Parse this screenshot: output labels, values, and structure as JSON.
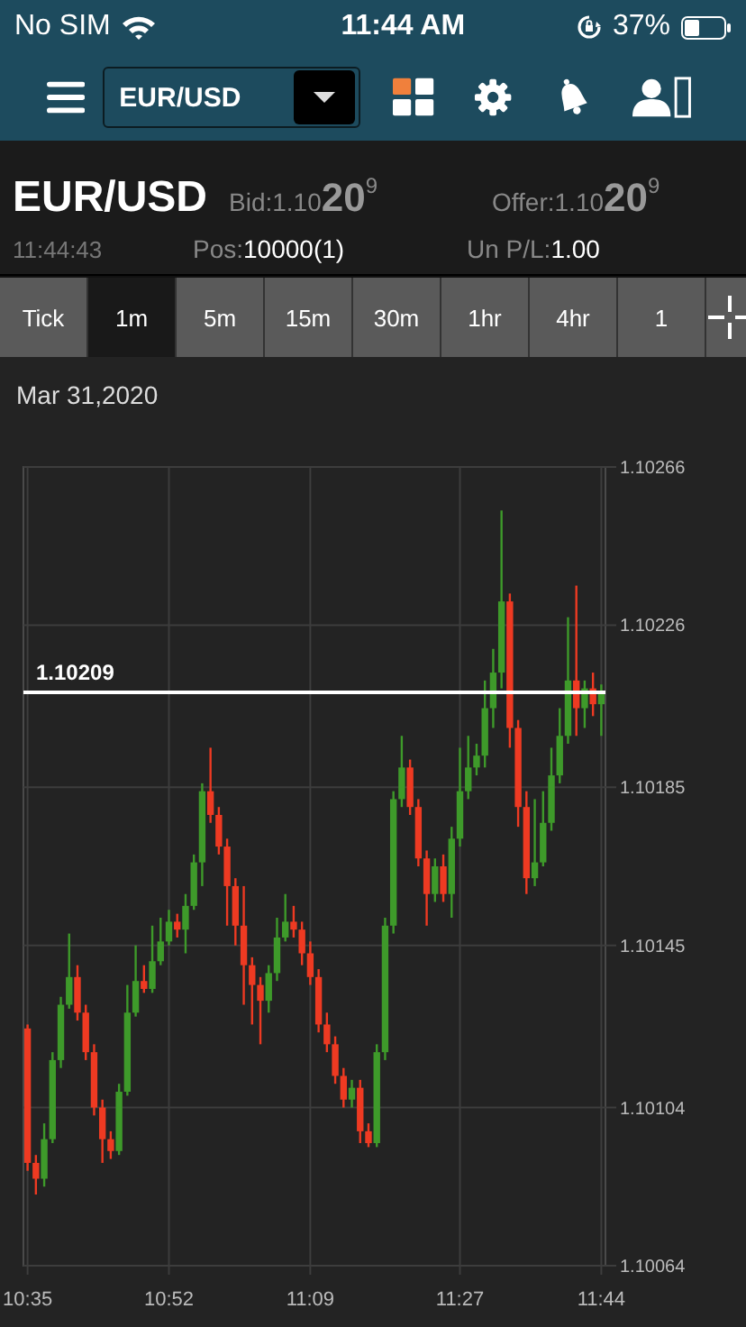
{
  "status_bar": {
    "carrier": "No SIM",
    "time": "11:44 AM",
    "battery": "37%"
  },
  "toolbar": {
    "symbol_select": {
      "value": "EUR/USD"
    }
  },
  "quote": {
    "symbol": "EUR/USD",
    "time": "11:44:43",
    "bid_label": "Bid:",
    "bid": "1.10**20**$^{9}$",
    "offer_label": "Offer:",
    "offer": "1.10**20**$^{9}$",
    "pos_label": "Pos:",
    "pos": "10000(1)",
    "pl_label": "Un P/L:",
    "pl": "1.00"
  },
  "tabs": [
    {
      "label": "Tick",
      "selected": false
    },
    {
      "label": "1m",
      "selected": true
    },
    {
      "label": "5m",
      "selected": false
    },
    {
      "label": "15m",
      "selected": false
    },
    {
      "label": "30m",
      "selected": false
    },
    {
      "label": "1hr",
      "selected": false
    },
    {
      "label": "4hr",
      "selected": false
    },
    {
      "label": "1",
      "selected": false
    }
  ],
  "chart": {
    "date": "Mar 31,2020",
    "chart_data": {
      "type": "candlestick",
      "ylim": [
        1.10064,
        1.10266
      ],
      "grid": true,
      "categories": [
        "10:35",
        null,
        null,
        null,
        null,
        null,
        null,
        null,
        null,
        null,
        null,
        null,
        null,
        null,
        null,
        null,
        null,
        "10:52",
        null,
        null,
        null,
        null,
        null,
        null,
        null,
        null,
        null,
        null,
        null,
        null,
        null,
        null,
        null,
        null,
        "11:09",
        null,
        null,
        null,
        null,
        null,
        null,
        null,
        null,
        null,
        null,
        null,
        null,
        null,
        null,
        null,
        null,
        null,
        "11:27",
        null,
        null,
        null,
        null,
        null,
        null,
        null,
        null,
        null,
        null,
        null,
        null,
        null,
        null,
        null,
        null,
        "11:44"
      ],
      "yticks": [
        1.10064,
        1.10104,
        1.10145,
        1.10185,
        1.10226,
        1.10266
      ],
      "ref_lines": [
        {
          "axis": "y",
          "value": 1.10209,
          "label": "1.10209"
        }
      ],
      "ohlc": [
        [
          1.10124,
          1.10125,
          1.10088,
          1.1009
        ],
        [
          1.1009,
          1.10092,
          1.10082,
          1.10086
        ],
        [
          1.10086,
          1.101,
          1.10084,
          1.10096
        ],
        [
          1.10096,
          1.10118,
          1.10095,
          1.10116
        ],
        [
          1.10116,
          1.10132,
          1.10114,
          1.1013
        ],
        [
          1.1013,
          1.10148,
          1.10129,
          1.10137
        ],
        [
          1.10137,
          1.1014,
          1.10126,
          1.10128
        ],
        [
          1.10128,
          1.1013,
          1.10116,
          1.10118
        ],
        [
          1.10118,
          1.1012,
          1.10102,
          1.10104
        ],
        [
          1.10104,
          1.10106,
          1.1009,
          1.10096
        ],
        [
          1.10096,
          1.10098,
          1.10091,
          1.10093
        ],
        [
          1.10093,
          1.1011,
          1.10092,
          1.10108
        ],
        [
          1.10108,
          1.10135,
          1.10107,
          1.10128
        ],
        [
          1.10128,
          1.10145,
          1.10127,
          1.10136
        ],
        [
          1.10136,
          1.1014,
          1.10133,
          1.10134
        ],
        [
          1.10134,
          1.1015,
          1.10133,
          1.10141
        ],
        [
          1.10141,
          1.10152,
          1.1014,
          1.10146
        ],
        [
          1.10146,
          1.10154,
          1.10145,
          1.10151
        ],
        [
          1.10151,
          1.10153,
          1.10147,
          1.10149
        ],
        [
          1.10149,
          1.10158,
          1.10143,
          1.10155
        ],
        [
          1.10155,
          1.10168,
          1.10154,
          1.10166
        ],
        [
          1.10166,
          1.10186,
          1.1016,
          1.10184
        ],
        [
          1.10184,
          1.10195,
          1.10176,
          1.10178
        ],
        [
          1.10178,
          1.1018,
          1.10168,
          1.1017
        ],
        [
          1.1017,
          1.10172,
          1.1015,
          1.1016
        ],
        [
          1.1016,
          1.10162,
          1.10145,
          1.1015
        ],
        [
          1.1015,
          1.1016,
          1.1013,
          1.1014
        ],
        [
          1.1014,
          1.10142,
          1.10125,
          1.10135
        ],
        [
          1.10135,
          1.10137,
          1.1012,
          1.10131
        ],
        [
          1.10131,
          1.1014,
          1.10128,
          1.10138
        ],
        [
          1.10138,
          1.10152,
          1.10136,
          1.10147
        ],
        [
          1.10147,
          1.10158,
          1.10146,
          1.10151
        ],
        [
          1.10151,
          1.10155,
          1.10147,
          1.10149
        ],
        [
          1.10149,
          1.10151,
          1.1014,
          1.10143
        ],
        [
          1.10143,
          1.10146,
          1.10135,
          1.10137
        ],
        [
          1.10137,
          1.10139,
          1.10123,
          1.10125
        ],
        [
          1.10125,
          1.10128,
          1.10118,
          1.1012
        ],
        [
          1.1012,
          1.10122,
          1.1011,
          1.10112
        ],
        [
          1.10112,
          1.10114,
          1.10104,
          1.10106
        ],
        [
          1.10106,
          1.10111,
          1.10104,
          1.10109
        ],
        [
          1.10109,
          1.10111,
          1.10095,
          1.10098
        ],
        [
          1.10098,
          1.101,
          1.10094,
          1.10095
        ],
        [
          1.10095,
          1.1012,
          1.10094,
          1.10118
        ],
        [
          1.10118,
          1.10152,
          1.10116,
          1.1015
        ],
        [
          1.1015,
          1.10184,
          1.10148,
          1.10182
        ],
        [
          1.10182,
          1.10198,
          1.1018,
          1.1019
        ],
        [
          1.1019,
          1.10192,
          1.10178,
          1.1018
        ],
        [
          1.1018,
          1.10182,
          1.10165,
          1.10167
        ],
        [
          1.10167,
          1.10169,
          1.1015,
          1.10158
        ],
        [
          1.10158,
          1.10167,
          1.10156,
          1.10165
        ],
        [
          1.10165,
          1.10168,
          1.10156,
          1.10158
        ],
        [
          1.10158,
          1.10175,
          1.10152,
          1.10172
        ],
        [
          1.10172,
          1.10195,
          1.1017,
          1.10184
        ],
        [
          1.10184,
          1.10198,
          1.10182,
          1.1019
        ],
        [
          1.1019,
          1.10196,
          1.10188,
          1.10193
        ],
        [
          1.10193,
          1.10212,
          1.1019,
          1.10205
        ],
        [
          1.10205,
          1.1022,
          1.102,
          1.10214
        ],
        [
          1.10214,
          1.10255,
          1.1021,
          1.10232
        ],
        [
          1.10232,
          1.10234,
          1.10195,
          1.102
        ],
        [
          1.102,
          1.10202,
          1.10175,
          1.1018
        ],
        [
          1.1018,
          1.10184,
          1.10158,
          1.10162
        ],
        [
          1.10162,
          1.10182,
          1.1016,
          1.10166
        ],
        [
          1.10166,
          1.10184,
          1.10165,
          1.10176
        ],
        [
          1.10176,
          1.10195,
          1.10174,
          1.10188
        ],
        [
          1.10188,
          1.10205,
          1.10186,
          1.10198
        ],
        [
          1.10198,
          1.10228,
          1.10196,
          1.10212
        ],
        [
          1.10212,
          1.10236,
          1.10198,
          1.10205
        ],
        [
          1.10205,
          1.10212,
          1.102,
          1.1021
        ],
        [
          1.1021,
          1.10214,
          1.10203,
          1.10206
        ],
        [
          1.10206,
          1.10211,
          1.10198,
          1.10209
        ]
      ]
    }
  }
}
